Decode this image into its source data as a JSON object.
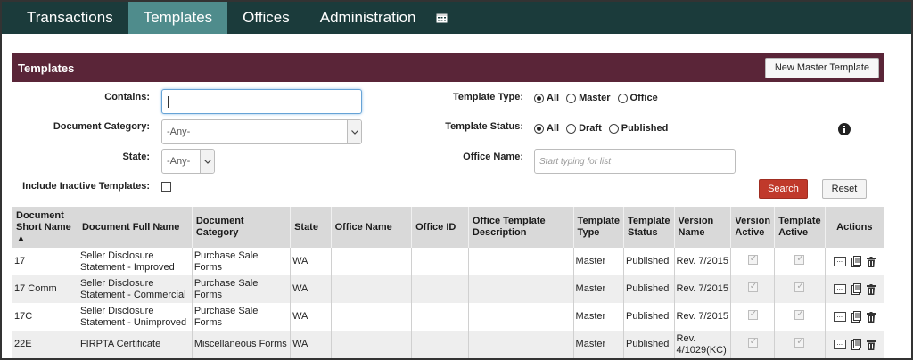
{
  "nav": {
    "tabs": [
      "Transactions",
      "Templates",
      "Offices",
      "Administration"
    ],
    "active": "Templates",
    "calendar_icon": "calendar-icon"
  },
  "panel": {
    "title": "Templates",
    "new_button": "New Master Template"
  },
  "filters": {
    "contains_label": "Contains:",
    "contains_value": "",
    "category_label": "Document Category:",
    "category_value": "-Any-",
    "state_label": "State:",
    "state_value": "-Any-",
    "inactive_label": "Include Inactive Templates:",
    "type_label": "Template Type:",
    "type_options": [
      "All",
      "Master",
      "Office"
    ],
    "type_selected": "All",
    "status_label": "Template Status:",
    "status_options": [
      "All",
      "Draft",
      "Published"
    ],
    "status_selected": "All",
    "office_label": "Office Name:",
    "office_placeholder": "Start typing for list",
    "search_button": "Search",
    "reset_button": "Reset"
  },
  "table": {
    "headers": {
      "short_name": "Document Short Name",
      "sort_arrow": "▲",
      "full_name": "Document Full Name",
      "category": "Document Category",
      "state": "State",
      "office_name": "Office Name",
      "office_id": "Office ID",
      "office_desc": "Office Template Description",
      "type": "Template Type",
      "status": "Template Status",
      "version_name": "Version Name",
      "version_active": "Version Active",
      "template_active": "Template Active",
      "actions": "Actions"
    },
    "rows": [
      {
        "short": "17",
        "full": "Seller Disclosure Statement - Improved",
        "category": "Purchase Sale Forms",
        "state": "WA",
        "office_name": "",
        "office_id": "",
        "desc": "",
        "type": "Master",
        "status": "Published",
        "version": "Rev. 7/2015"
      },
      {
        "short": "17 Comm",
        "full": "Seller Disclosure Statement - Commercial",
        "category": "Purchase Sale Forms",
        "state": "WA",
        "office_name": "",
        "office_id": "",
        "desc": "",
        "type": "Master",
        "status": "Published",
        "version": "Rev. 7/2015"
      },
      {
        "short": "17C",
        "full": "Seller Disclosure Statement - Unimproved",
        "category": "Purchase Sale Forms",
        "state": "WA",
        "office_name": "",
        "office_id": "",
        "desc": "",
        "type": "Master",
        "status": "Published",
        "version": "Rev. 7/2015"
      },
      {
        "short": "22E",
        "full": "FIRPTA Certificate",
        "category": "Miscellaneous Forms",
        "state": "WA",
        "office_name": "",
        "office_id": "",
        "desc": "",
        "type": "Master",
        "status": "Published",
        "version": "Rev. 4/1029(KC)"
      }
    ]
  },
  "colors": {
    "nav_bg": "#1b3b3b",
    "nav_active": "#4f8c8c",
    "panel_bg": "#5a2538",
    "search_btn": "#c0392b"
  }
}
